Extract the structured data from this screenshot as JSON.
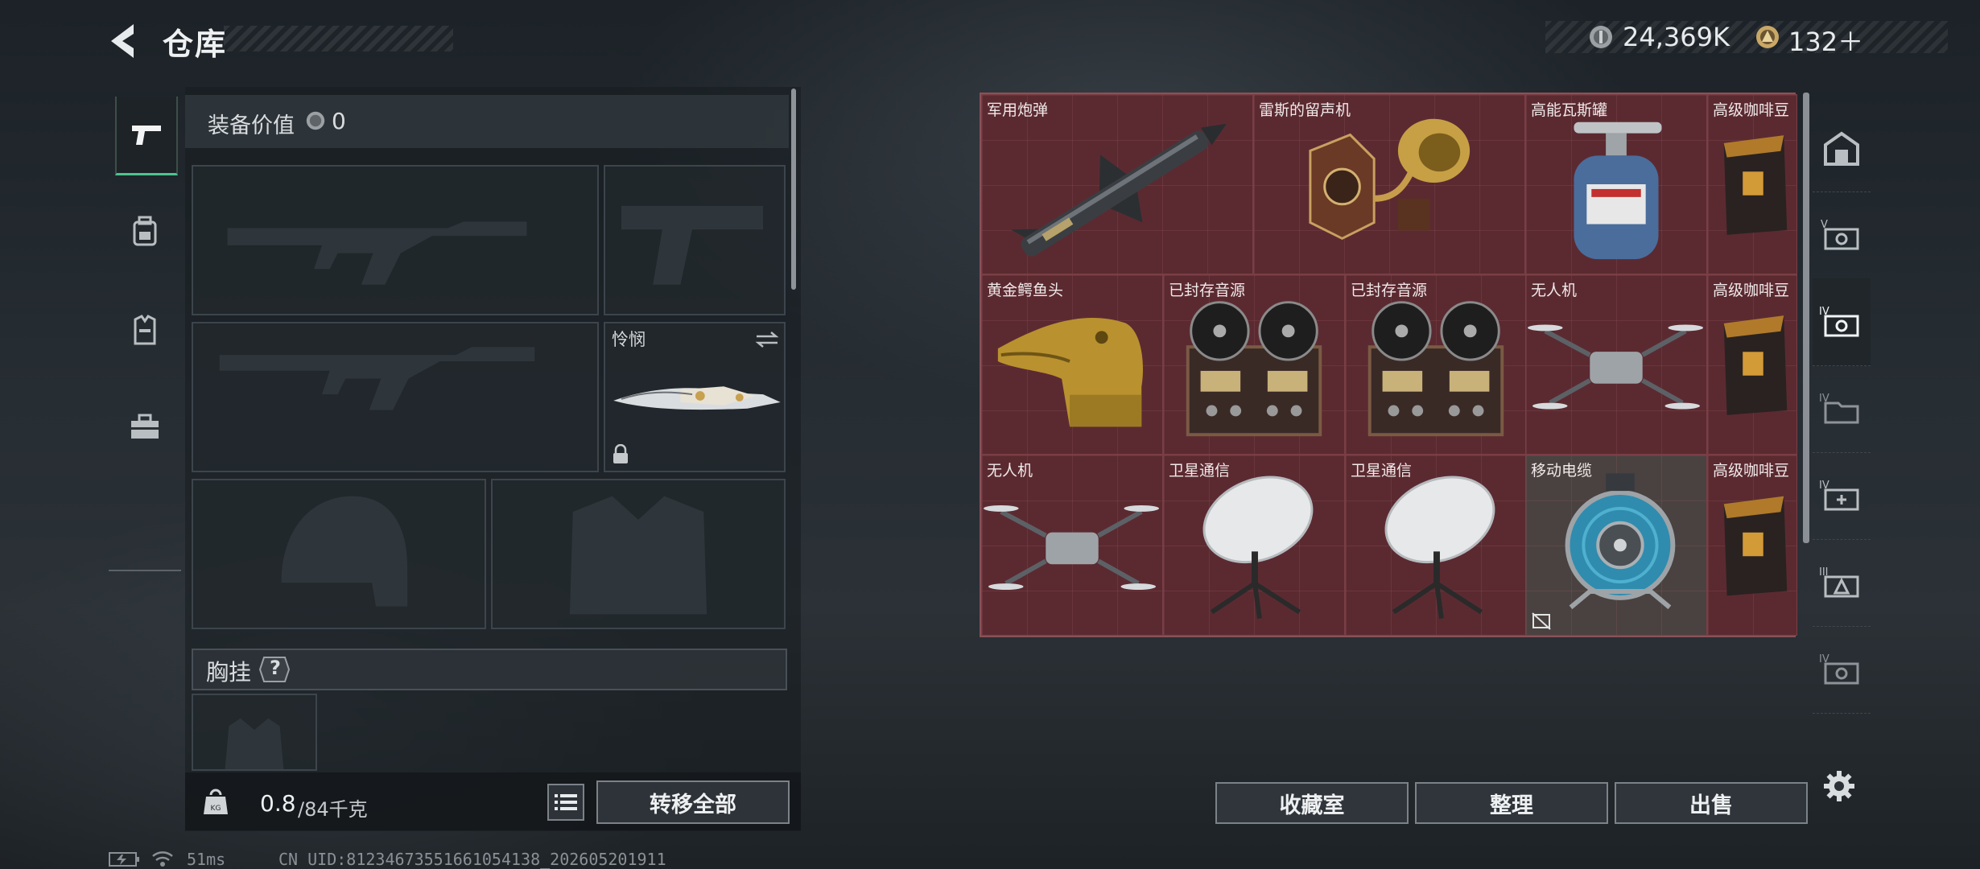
{
  "header": {
    "title": "仓库",
    "currency": [
      {
        "icon": "silver-coin-icon",
        "value": "24,369K"
      },
      {
        "icon": "gold-coin-icon",
        "value": "132＋"
      }
    ]
  },
  "left_nav": [
    "pistol-tab-icon",
    "backpack-tab-icon",
    "vest-tab-icon",
    "toolbox-tab-icon"
  ],
  "equipment": {
    "value_label": "装备价值",
    "value": "0",
    "melee_label": "怜悯",
    "chest_label": "胸挂",
    "chest_help": "?",
    "weight_current": "0.8",
    "weight_max": "/84千克",
    "transfer_all": "转移全部"
  },
  "stash_grid": {
    "items": [
      {
        "label": "军用炮弹",
        "icon": "missile-icon"
      },
      {
        "label": "雷斯的留声机",
        "icon": "gramophone-icon"
      },
      {
        "label": "高能瓦斯罐",
        "icon": "gas-canister-icon"
      },
      {
        "label": "高级咖啡豆",
        "icon": "coffee-bag-icon"
      },
      {
        "label": "黄金鳄鱼头",
        "icon": "gold-crocodile-icon"
      },
      {
        "label": "已封存音源",
        "icon": "reel-recorder-icon"
      },
      {
        "label": "已封存音源",
        "icon": "reel-recorder-icon"
      },
      {
        "label": "无人机",
        "icon": "drone-icon"
      },
      {
        "label": "高级咖啡豆",
        "icon": "coffee-bag-icon"
      },
      {
        "label": "无人机",
        "icon": "drone-icon"
      },
      {
        "label": "卫星通信",
        "icon": "satellite-dish-icon"
      },
      {
        "label": "卫星通信",
        "icon": "satellite-dish-icon"
      },
      {
        "label": "移动电缆",
        "icon": "cable-reel-icon"
      },
      {
        "label": "高级咖啡豆",
        "icon": "coffee-bag-icon"
      }
    ]
  },
  "actions": {
    "collection": "收藏室",
    "sort": "整理",
    "sell": "出售"
  },
  "status_bar": {
    "ping": "51ms",
    "uid": "CN UID:8123467355166105413​8_202605201911"
  }
}
